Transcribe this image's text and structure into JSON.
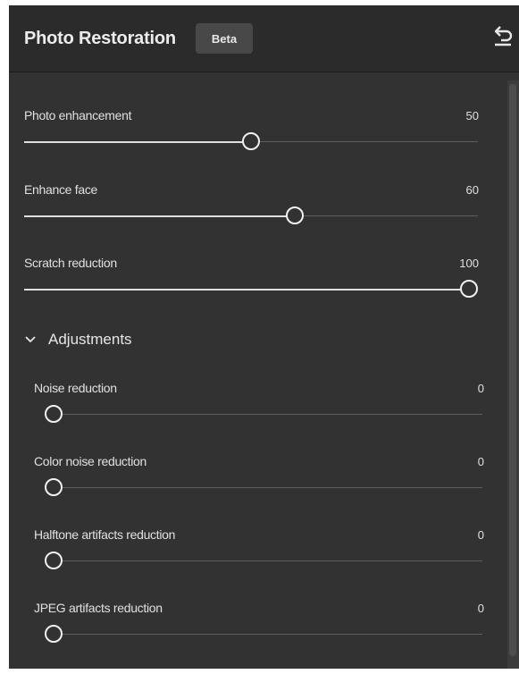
{
  "header": {
    "title": "Photo Restoration",
    "badge": "Beta"
  },
  "sliders": [
    {
      "label": "Photo enhancement",
      "value": "50",
      "level": 0.5
    },
    {
      "label": "Enhance face",
      "value": "60",
      "level": 0.6
    },
    {
      "label": "Scratch reduction",
      "value": "100",
      "level": 1.0
    }
  ],
  "adjustments": {
    "title": "Adjustments",
    "sliders": [
      {
        "label": "Noise reduction",
        "value": "0",
        "level": 0
      },
      {
        "label": "Color noise reduction",
        "value": "0",
        "level": 0
      },
      {
        "label": "Halftone artifacts reduction",
        "value": "0",
        "level": 0
      },
      {
        "label": "JPEG artifacts reduction",
        "value": "0",
        "level": 0
      }
    ]
  },
  "icons": {
    "undo": "undo-icon",
    "chevron": "chevron-down-icon"
  },
  "colors": {
    "panel": "#323232",
    "header": "#2b2b2b",
    "badge": "#484848",
    "text": "#e0e0e0"
  }
}
